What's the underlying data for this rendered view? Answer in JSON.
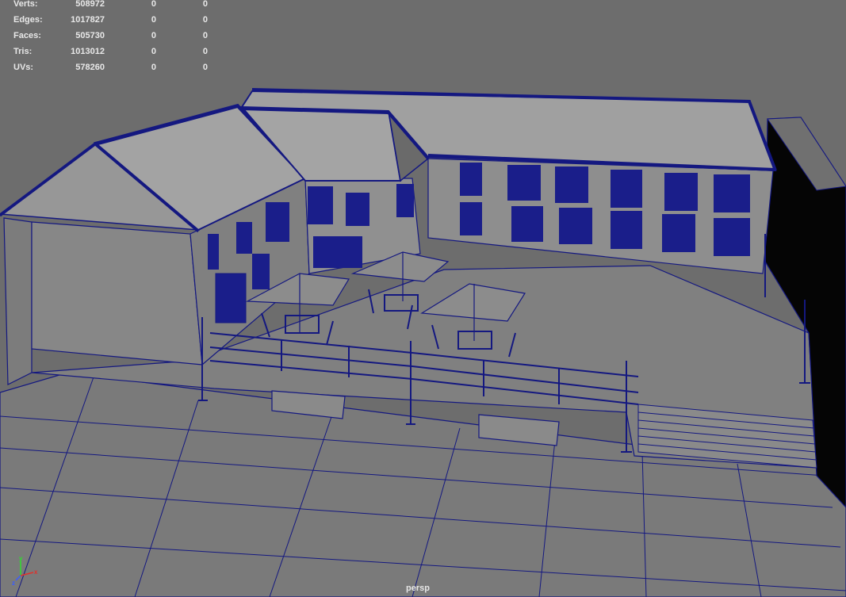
{
  "hud": {
    "rows": [
      {
        "label": "Verts:",
        "total": "508972",
        "selected": "0",
        "component": "0"
      },
      {
        "label": "Edges:",
        "total": "1017827",
        "selected": "0",
        "component": "0"
      },
      {
        "label": "Faces:",
        "total": "505730",
        "selected": "0",
        "component": "0"
      },
      {
        "label": "Tris:",
        "total": "1013012",
        "selected": "0",
        "component": "0"
      },
      {
        "label": "UVs:",
        "total": "578260",
        "selected": "0",
        "component": "0"
      }
    ]
  },
  "viewport": {
    "camera": "persp",
    "wire_color": "#141880",
    "axes": {
      "x": "x",
      "y": "y",
      "z": "z"
    },
    "axis_colors": {
      "x": "#e0302c",
      "y": "#2ce02c",
      "z": "#3a5cff"
    }
  }
}
